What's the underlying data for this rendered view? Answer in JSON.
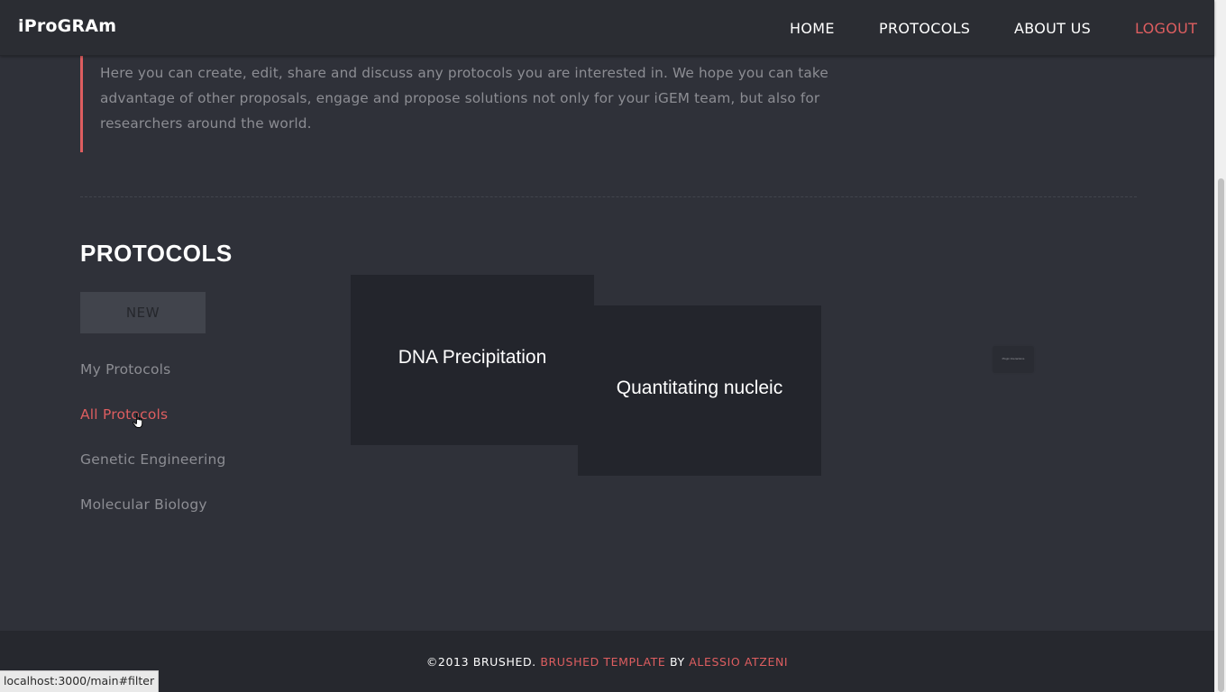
{
  "navbar": {
    "brand": "iProGRAm",
    "links": [
      {
        "label": "HOME"
      },
      {
        "label": "PROTOCOLS"
      },
      {
        "label": "ABOUT US"
      },
      {
        "label": "LOGOUT"
      }
    ]
  },
  "intro": {
    "text": "Here you can create, edit, share and discuss any protocols you are interested in. We hope you can take advantage of other proposals, engage and propose solutions not only for your iGEM team, but also for researchers around the world."
  },
  "protocols": {
    "title": "PROTOCOLS",
    "new_button": "NEW",
    "filters": [
      {
        "label": "My Protocols",
        "active": false
      },
      {
        "label": "All Protocols",
        "active": true
      },
      {
        "label": "Genetic Engineering",
        "active": false
      },
      {
        "label": "Molecular Biology",
        "active": false
      }
    ],
    "cards": [
      {
        "title": "DNA Precipitation"
      },
      {
        "title": "Quantitating nucleic"
      }
    ],
    "tiny_card": {
      "title": "Plugin Interactions"
    }
  },
  "footer": {
    "copyright": "©2013 BRUSHED.",
    "template_link": "BRUSHED TEMPLATE",
    "by": "BY",
    "author_link": "ALESSIO ATZENI"
  },
  "status_bar": {
    "url": "localhost:3000/main#filter"
  },
  "colors": {
    "accent": "#de5e60",
    "background": "#2f3139",
    "navbar": "#2b2d33",
    "card": "#23252c",
    "footer": "#26282e"
  },
  "icons": {
    "cursor": "hand-pointer-icon"
  }
}
